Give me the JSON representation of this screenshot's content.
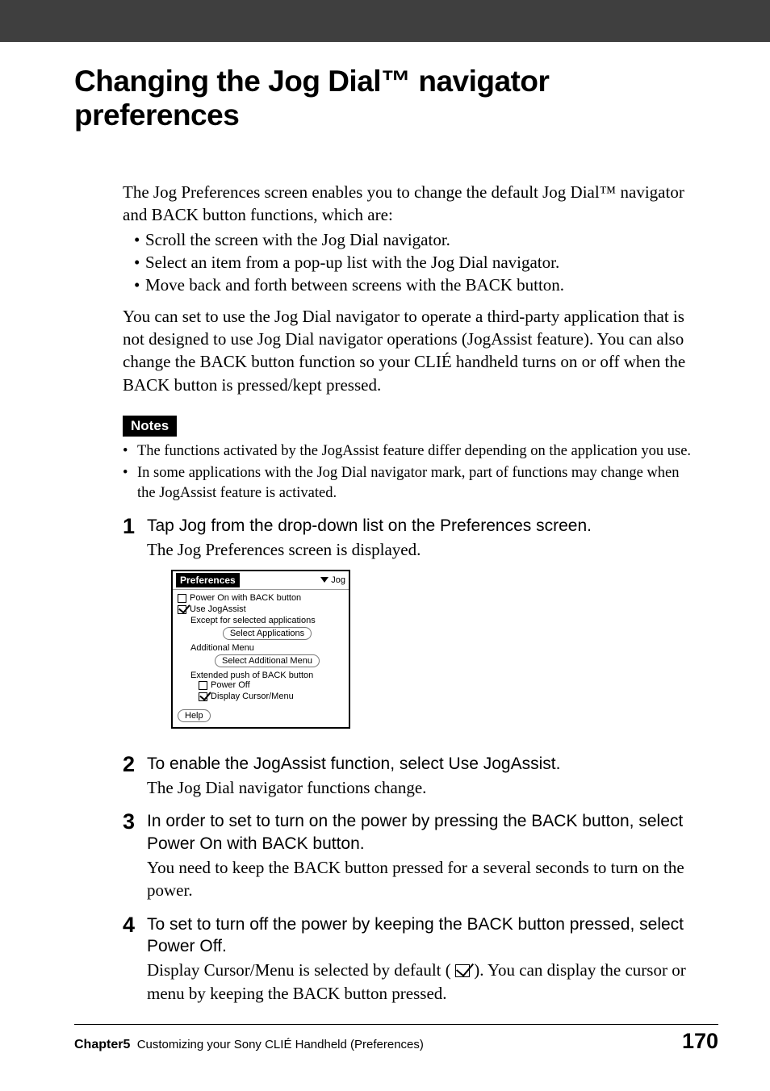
{
  "title": "Changing the Jog Dial™ navigator preferences",
  "intro": {
    "p1": "The Jog Preferences screen enables you to change the default Jog Dial™ navigator and BACK button functions, which are:",
    "bullets": [
      "Scroll the screen with the Jog Dial navigator.",
      "Select an item from a pop-up list with the Jog Dial navigator.",
      "Move back and forth between screens with the BACK button."
    ],
    "p2": "You can set to use the Jog Dial navigator to operate a third-party application that is not designed to use Jog Dial navigator operations (JogAssist feature). You can also change the BACK button function so your CLIÉ handheld turns on or off when the BACK button is pressed/kept pressed."
  },
  "notes": {
    "label": "Notes",
    "items": [
      "The functions activated by the JogAssist feature differ depending on the application you use.",
      "In some applications with the Jog Dial navigator mark, part of functions may change when the JogAssist feature is activated."
    ]
  },
  "steps": [
    {
      "num": "1",
      "heading": "Tap Jog from the drop-down list on the Preferences screen.",
      "desc": "The Jog Preferences screen is displayed."
    },
    {
      "num": "2",
      "heading": "To enable the JogAssist function, select Use JogAssist.",
      "desc": "The Jog Dial navigator functions change."
    },
    {
      "num": "3",
      "heading": "In order to set to turn on the power by pressing the BACK button, select Power On with BACK button.",
      "desc": "You need to keep the BACK button pressed for a several seconds to turn on the power."
    },
    {
      "num": "4",
      "heading": "To set to turn off the power by keeping the BACK button pressed, select Power Off.",
      "desc_pre": "Display Cursor/Menu is selected by default (",
      "desc_post": ").  You can display the cursor or menu by keeping the BACK button pressed."
    }
  ],
  "screenshot": {
    "title": "Preferences",
    "dropdown": "Jog",
    "row1": "Power On with BACK button",
    "row2": "Use JogAssist",
    "except": "Except for selected applications",
    "btn1": "Select Applications",
    "addmenu": "Additional Menu",
    "btn2": "Select Additional Menu",
    "extpush": "Extended push of BACK button",
    "poweroff": "Power Off",
    "dispcursor": "Display Cursor/Menu",
    "help": "Help"
  },
  "footer": {
    "chapter": "Chapter5",
    "chapter_desc": "Customizing your Sony CLIÉ Handheld (Preferences)",
    "page": "170"
  }
}
